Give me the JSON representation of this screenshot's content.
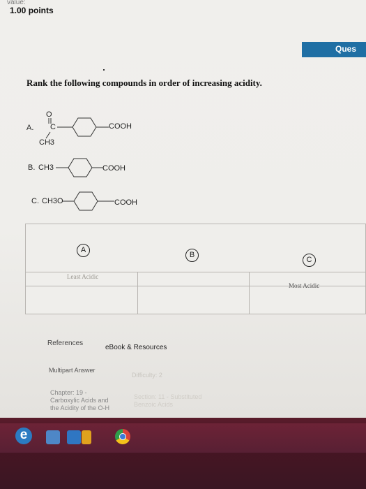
{
  "header": {
    "value_label": "value:",
    "points": "1.00 points",
    "tab_label": "Ques"
  },
  "question": {
    "text": "Rank the following compounds in order of increasing acidity.",
    "options": [
      {
        "letter": "A.",
        "substituent_top": "O",
        "substituent_mid": "C",
        "substituent_bottom": "CH3",
        "group": "COOH"
      },
      {
        "letter": "B.",
        "substituent": "CH3",
        "group": "COOH"
      },
      {
        "letter": "C.",
        "substituent": "CH3O",
        "group": "COOH"
      }
    ]
  },
  "ranking": {
    "choices": [
      "A",
      "B",
      "C"
    ],
    "least_label": "Least Acidic",
    "most_label": "Most Acidic"
  },
  "footer_tabs": {
    "references": "References",
    "ebook": "eBook & Resources"
  },
  "meta": {
    "type": "Multipart Answer",
    "difficulty": "Difficulty: 2",
    "chapter_line1": "Chapter: 19 -",
    "chapter_line2": "Carboxylic Acids and",
    "chapter_line3": "the Acidity of the O-H",
    "section_line1": "Section: 11 - Substituted",
    "section_line2": "Benzoic Acids"
  },
  "taskbar": {
    "icons": [
      "internet-explorer-icon",
      "folder-icon",
      "app-icon",
      "app-icon",
      "chrome-icon"
    ],
    "ie_glyph": "e",
    "colors": {
      "taskbar": "#4a1523",
      "tab_blue": "#1f6fa4"
    }
  }
}
